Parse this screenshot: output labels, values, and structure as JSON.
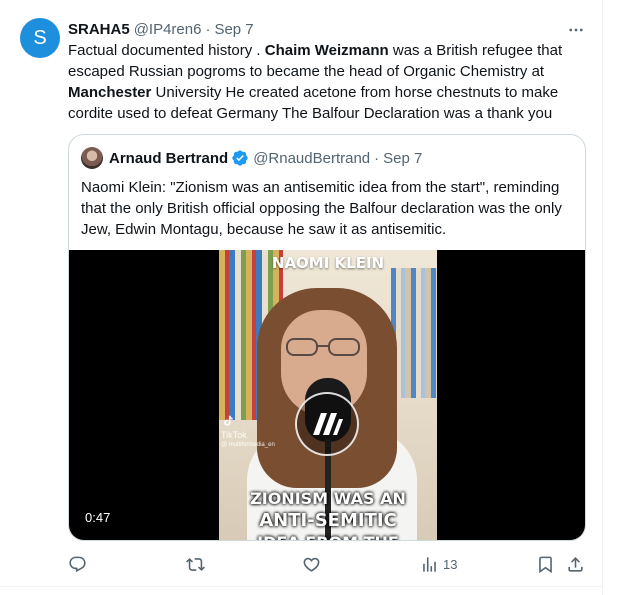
{
  "tweet": {
    "avatar_letter": "S",
    "author_name": "SRAHA5",
    "handle": "@IP4ren6",
    "dot": "·",
    "date": "Sep 7",
    "text_parts": [
      "Factual documented history . ",
      "Chaim Weizmann",
      " was a British refugee that escaped Russian pogroms to became the head of Organic Chemistry  at ",
      "Manchester",
      " University He created acetone from horse chestnuts to make cordite used to defeat Germany The Balfour Declaration was a thank you"
    ]
  },
  "quote": {
    "author_name": "Arnaud Bertrand",
    "handle": "@RnaudBertrand",
    "dot": "·",
    "date": "Sep 7",
    "text": "Naomi Klein: \"Zionism was an antisemitic idea from the start\", reminding that the only British official opposing the Balfour declaration was the only Jew, Edwin Montagu, because he saw it as antisemitic.",
    "video": {
      "overlay_title": "NAOMI KLEIN",
      "caption_line1": "ZIONISM WAS AN",
      "caption_line2": "ANTI-SEMITIC",
      "caption_line3": "IDEA FROM THE",
      "tiktok_label": "TikTok",
      "tiktok_user": "@ multiformedia_en",
      "duration": "0:47"
    }
  },
  "actions": {
    "reply_count": "",
    "retweet_count": "",
    "like_count": "",
    "views_count": "13"
  },
  "icons": {
    "more": "more-icon",
    "verified": "verified-badge-icon",
    "reply": "reply-icon",
    "retweet": "retweet-icon",
    "like": "like-icon",
    "views": "views-icon",
    "bookmark": "bookmark-icon",
    "share": "share-icon",
    "tiktok": "tiktok-logo-icon",
    "play": "play-logo-icon"
  },
  "colors": {
    "avatar_bg": "#1d8fdc",
    "verified": "#1d9bf0",
    "secondary_text": "#536471",
    "border": "#cfd9de"
  }
}
